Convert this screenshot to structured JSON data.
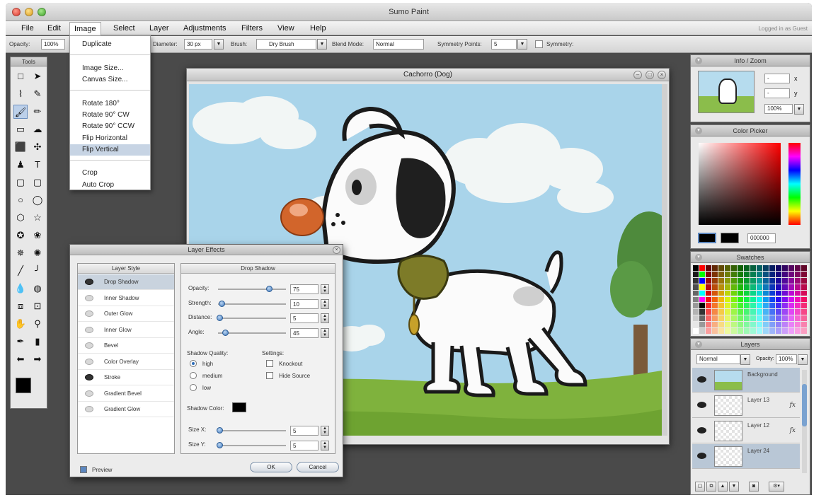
{
  "app": {
    "title": "Sumo Paint",
    "login_status": "Logged in as Guest"
  },
  "menubar": {
    "items": [
      "File",
      "Edit",
      "Image",
      "Select",
      "Layer",
      "Adjustments",
      "Filters",
      "View",
      "Help"
    ]
  },
  "options": {
    "opacity_label": "Opacity:",
    "opacity_value": "100%",
    "diameter_label": "Diameter:",
    "diameter_value": "30 px",
    "brush_label": "Brush:",
    "brush_value": "Dry Brush",
    "blend_label": "Blend Mode:",
    "blend_value": "Normal",
    "sym_points_label": "Symmetry Points:",
    "sym_points_value": "5",
    "symmetry_label": "Symmetry:"
  },
  "image_menu": {
    "items": [
      "Duplicate",
      "Image Size...",
      "Canvas Size...",
      "Rotate 180°",
      "Rotate 90° CW",
      "Rotate 90° CCW",
      "Flip Horizontal",
      "Flip Vertical",
      "Crop",
      "Auto Crop"
    ],
    "highlighted": "Flip Vertical"
  },
  "tools": {
    "title": "Tools",
    "icons": [
      "marquee-icon",
      "arrow-icon",
      "lasso-icon",
      "pen-icon",
      "brush-icon",
      "pencil-icon",
      "eraser-icon",
      "smudge-icon",
      "fill-icon",
      "clone-icon",
      "stamp-icon",
      "text-icon",
      "rectangle-icon",
      "rounded-rect-icon",
      "ellipse-icon",
      "shape-icon",
      "polygon-icon",
      "star-icon",
      "star-burst-icon",
      "flower-icon",
      "spiral-icon",
      "gear-shape-icon",
      "line-icon",
      "curve-icon",
      "drop-icon",
      "blur-icon",
      "crop-icon",
      "transform-icon",
      "hand-icon",
      "zoom-icon",
      "eyedropper-icon",
      "color-sample-icon",
      "undo-arrow-icon",
      "redo-arrow-icon"
    ],
    "glyphs": [
      "□",
      "➤",
      "⌇",
      "✎",
      "🖌",
      "✏",
      "▭",
      "☁",
      "⬛",
      "✣",
      "♟",
      "T",
      "▢",
      "▢",
      "○",
      "◯",
      "⬡",
      "☆",
      "✪",
      "❀",
      "✵",
      "✺",
      "╱",
      "╯",
      "💧",
      "◍",
      "⧈",
      "⊡",
      "✋",
      "⚲",
      "✒",
      "▮",
      "⬅",
      "➡"
    ]
  },
  "document": {
    "title": "Cachorro (Dog)",
    "colors": {
      "sky": "#a9d4ea",
      "grass": "#7fb23d",
      "tree": "#4e8a3c",
      "nose": "#d2652b",
      "collar": "#7d7b28"
    }
  },
  "layer_effects": {
    "title": "Layer Effects",
    "styles_header": "Layer Style",
    "styles": [
      "Drop Shadow",
      "Inner Shadow",
      "Outer Glow",
      "Inner Glow",
      "Bevel",
      "Color Overlay",
      "Stroke",
      "Gradient Bevel",
      "Gradient Glow"
    ],
    "styles_on": [
      true,
      false,
      false,
      false,
      false,
      false,
      true,
      false,
      false
    ],
    "selected_style": "Drop Shadow",
    "panel_title": "Drop Shadow",
    "sliders": [
      {
        "label": "Opacity:",
        "value": "75",
        "fraction": 0.75
      },
      {
        "label": "Strength:",
        "value": "10",
        "fraction": 0.05
      },
      {
        "label": "Distance:",
        "value": "5",
        "fraction": 0.02
      },
      {
        "label": "Angle:",
        "value": "45",
        "fraction": 0.1
      }
    ],
    "quality_label": "Shadow Quality:",
    "quality_options": [
      "high",
      "medium",
      "low"
    ],
    "quality_selected": "high",
    "settings_label": "Settings:",
    "settings_options": [
      "Knockout",
      "Hide Source"
    ],
    "shadow_color_label": "Shadow Color:",
    "shadow_color": "#000000",
    "size_sliders": [
      {
        "label": "Size X:",
        "value": "5"
      },
      {
        "label": "Size Y:",
        "value": "5"
      }
    ],
    "preview_label": "Preview",
    "ok_label": "OK",
    "cancel_label": "Cancel"
  },
  "info_zoom": {
    "title": "Info / Zoom",
    "x_value": "-",
    "y_value": "-",
    "x_label": "x",
    "y_label": "y",
    "zoom_value": "100%"
  },
  "color_picker": {
    "title": "Color Picker",
    "hex_value": "000000"
  },
  "swatches": {
    "title": "Swatches"
  },
  "layers": {
    "title": "Layers",
    "blend_mode": "Normal",
    "opacity_label": "Opacity:",
    "opacity_value": "100%",
    "items": [
      {
        "name": "Background",
        "fx": "",
        "selected": true
      },
      {
        "name": "Layer 13",
        "fx": "fx",
        "selected": false
      },
      {
        "name": "Layer 12",
        "fx": "fx",
        "selected": false
      },
      {
        "name": "Layer 24",
        "fx": "",
        "selected": true
      }
    ]
  }
}
